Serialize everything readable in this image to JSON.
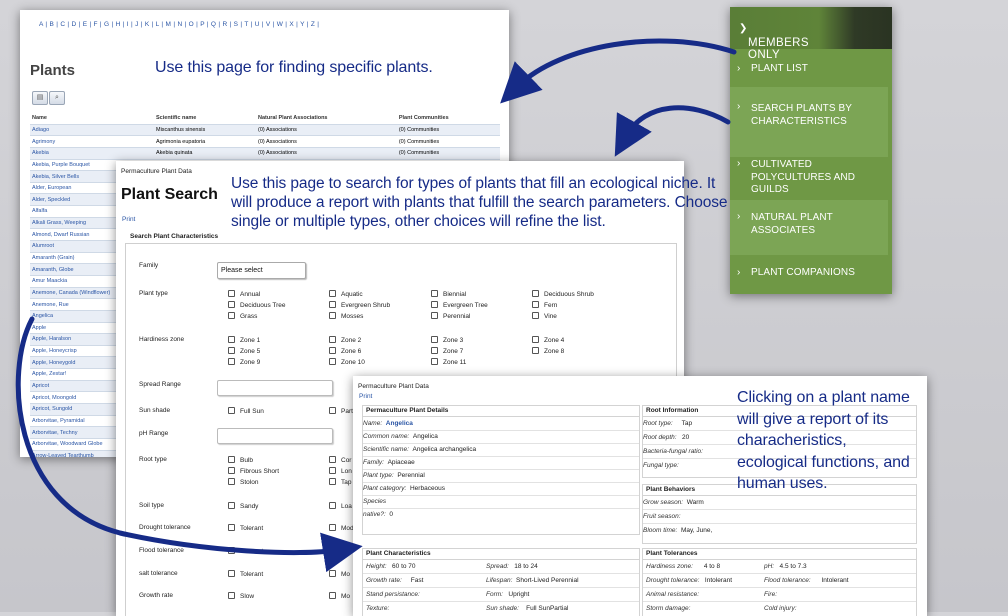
{
  "plants_page": {
    "alphabet": "A | B | C | D | E | F | G | H | I | J | K | L | M | N | O | P | Q | R | S | T | U | V | W | X | Y | Z |",
    "title": "Plants",
    "caption": "Use this page for finding specific plants.",
    "toolbar": [
      "columns-icon",
      "search-icon"
    ],
    "columns": [
      "Name",
      "Scientific name",
      "Natural Plant Associations",
      "Plant Communities"
    ],
    "rows": [
      {
        "name": "Adiago",
        "sci": "Miscanthus sinensis",
        "assoc": "(0) Associations",
        "comm": "(0) Communities"
      },
      {
        "name": "Agrimony",
        "sci": "Agrimonia eupatoria",
        "assoc": "(0) Associations",
        "comm": "(0) Communities"
      },
      {
        "name": "Akebia",
        "sci": "Akebia quinata",
        "assoc": "(0) Associations",
        "comm": "(0) Communities"
      },
      {
        "name": "Akebia, Purple Bouquet",
        "sci": "",
        "assoc": "",
        "comm": ""
      },
      {
        "name": "Akebia, Silver Bells",
        "sci": "",
        "assoc": "",
        "comm": ""
      },
      {
        "name": "Alder, European",
        "sci": "",
        "assoc": "",
        "comm": ""
      },
      {
        "name": "Alder, Speckled",
        "sci": "",
        "assoc": "",
        "comm": ""
      },
      {
        "name": "Alfalfa",
        "sci": "",
        "assoc": "",
        "comm": ""
      },
      {
        "name": "Alkali Grass, Weeping",
        "sci": "",
        "assoc": "",
        "comm": ""
      },
      {
        "name": "Almond, Dwarf Russian",
        "sci": "",
        "assoc": "",
        "comm": ""
      },
      {
        "name": "Alumroot",
        "sci": "",
        "assoc": "",
        "comm": ""
      },
      {
        "name": "Amaranth (Grain)",
        "sci": "",
        "assoc": "",
        "comm": ""
      },
      {
        "name": "Amaranth, Globe",
        "sci": "",
        "assoc": "",
        "comm": ""
      },
      {
        "name": "Amur Maackia",
        "sci": "",
        "assoc": "",
        "comm": ""
      },
      {
        "name": "Anemone, Canada (Windflower)",
        "sci": "",
        "assoc": "",
        "comm": ""
      },
      {
        "name": "Anemone, Rue",
        "sci": "",
        "assoc": "",
        "comm": ""
      },
      {
        "name": "Angelica",
        "sci": "",
        "assoc": "",
        "comm": ""
      },
      {
        "name": "Apple",
        "sci": "",
        "assoc": "",
        "comm": ""
      },
      {
        "name": "Apple, Haralson",
        "sci": "",
        "assoc": "",
        "comm": ""
      },
      {
        "name": "Apple, Honeycrisp",
        "sci": "",
        "assoc": "",
        "comm": ""
      },
      {
        "name": "Apple, Honeygold",
        "sci": "",
        "assoc": "",
        "comm": ""
      },
      {
        "name": "Apple, Zestar!",
        "sci": "",
        "assoc": "",
        "comm": ""
      },
      {
        "name": "Apricot",
        "sci": "",
        "assoc": "",
        "comm": ""
      },
      {
        "name": "Apricot, Moongold",
        "sci": "",
        "assoc": "",
        "comm": ""
      },
      {
        "name": "Apricot, Sungold",
        "sci": "",
        "assoc": "",
        "comm": ""
      },
      {
        "name": "Arborvitae, Pyramidal",
        "sci": "",
        "assoc": "",
        "comm": ""
      },
      {
        "name": "Arborvitae, Techny",
        "sci": "",
        "assoc": "",
        "comm": ""
      },
      {
        "name": "Arborvitae, Woodward Globe",
        "sci": "",
        "assoc": "",
        "comm": ""
      },
      {
        "name": "Arrow-Leaved Tearthumb",
        "sci": "",
        "assoc": "",
        "comm": ""
      }
    ]
  },
  "members_menu": {
    "header": "MEMBERS ONLY",
    "items": [
      {
        "label": "PLANT LIST"
      },
      {
        "label": "SEARCH PLANTS BY CHARACTERISTICS"
      },
      {
        "label": "CULTIVATED POLYCULTURES AND GUILDS"
      },
      {
        "label": "NATURAL PLANT ASSOCIATES"
      },
      {
        "label": "PLANT COMPANIONS"
      }
    ]
  },
  "search_page": {
    "site": "Permaculture Plant Data",
    "title": "Plant Search",
    "print": "Print",
    "section": "Search Plant Characteristics",
    "caption": "Use this page to search for types of plants that fill an ecological niche. It will produce a report with plants that fulfill the search parameters. Choose single or multiple types, other choices will refine the list.",
    "family_label": "Family",
    "family_value": "Please select",
    "plant_type_label": "Plant type",
    "plant_types": [
      "Annual",
      "Aquatic",
      "Biennial",
      "Deciduous Shrub",
      "Deciduous Tree",
      "Evergreen Shrub",
      "Evergreen Tree",
      "Fern",
      "Grass",
      "Mosses",
      "Perennial",
      "Vine"
    ],
    "hardiness_label": "Hardiness zone",
    "zones": [
      "Zone 1",
      "Zone 2",
      "Zone 3",
      "Zone 4",
      "Zone 5",
      "Zone 6",
      "Zone 7",
      "Zone 8",
      "Zone 9",
      "Zone 10",
      "Zone 11"
    ],
    "spread_label": "Spread Range",
    "sun_label": "Sun shade",
    "sun_options": [
      "Full Sun",
      "Part"
    ],
    "ph_label": "pH Range",
    "root_label": "Root type",
    "root_options": [
      "Bulb",
      "Fibrous Short",
      "Stolon"
    ],
    "root_cut": [
      "Cor",
      "Lon",
      "Tap"
    ],
    "soil_label": "Soil type",
    "soil_options": [
      "Sandy"
    ],
    "soil_cut": "Loa",
    "drought_label": "Drought tolerance",
    "drought_options": [
      "Tolerant"
    ],
    "drought_cut": "Mod",
    "flood_label": "Flood tolerance",
    "flood_options": [
      "Tolerant"
    ],
    "salt_label": "salt tolerance",
    "salt_options": [
      "Tolerant"
    ],
    "salt_cut": "Mo",
    "growth_label": "Growth rate",
    "growth_options": [
      "Slow"
    ],
    "growth_cut": "Mo"
  },
  "detail_page": {
    "site": "Permaculture Plant Data",
    "print": "Print",
    "caption": "Clicking on a plant name will give a report of its characheristics, ecological functions, and human uses.",
    "details_header": "Permaculture Plant Details",
    "name_label": "Name:",
    "name_value": "Angelica",
    "common_label": "Common name:",
    "common_value": "Angelica",
    "sci_label": "Scientific name:",
    "sci_value": "Angelica archangelica",
    "family_label": "Family:",
    "family_value": "Apiaceae",
    "type_label": "Plant type:",
    "type_value": "Perennial",
    "category_label": "Plant category:",
    "category_value": "Herbaceous",
    "species_label": "Species",
    "native_label": "native?:",
    "native_value": "0",
    "root_header": "Root Information",
    "roottype_label": "Root type:",
    "roottype_value": "Tap",
    "rootdepth_label": "Root depth:",
    "rootdepth_value": "20",
    "bact_label": "Bacteria-fungal ratio:",
    "fungal_label": "Fungal type:",
    "behaviors_header": "Plant Behaviors",
    "grow_label": "Grow season:",
    "grow_value": "Warm",
    "fruit_label": "Fruit season:",
    "bloom_label": "Bloom time:",
    "bloom_value": "May, June,",
    "char_header": "Plant Characteristics",
    "height_label": "Height:",
    "height_value": "60 to 70",
    "spread_label": "Spread:",
    "spread_value": "18 to 24",
    "growth_label": "Growth rate:",
    "growth_value": "Fast",
    "lifespan_label": "Lifespan:",
    "lifespan_value": "Short-Lived Perennial",
    "stand_label": "Stand persistance:",
    "form_label": "Form:",
    "form_value": "Upright",
    "texture_label": "Texture:",
    "sunshade_label": "Sun shade:",
    "sunshade_value": "Full SunPartial",
    "tol_header": "Plant Tolerances",
    "hz_label": "Hardiness zone:",
    "hz_value": "4 to 8",
    "ph_label": "pH:",
    "ph_value": "4.5 to 7.3",
    "drought_label": "Drought tolerance:",
    "drought_value": "Intolerant",
    "flood_label": "Flood tolerance:",
    "flood_value": "Intolerant",
    "animal_label": "Animal resistance:",
    "fire_label": "Fire:",
    "storm_label": "Storm damage:",
    "cold_label": "Cold injury:"
  }
}
